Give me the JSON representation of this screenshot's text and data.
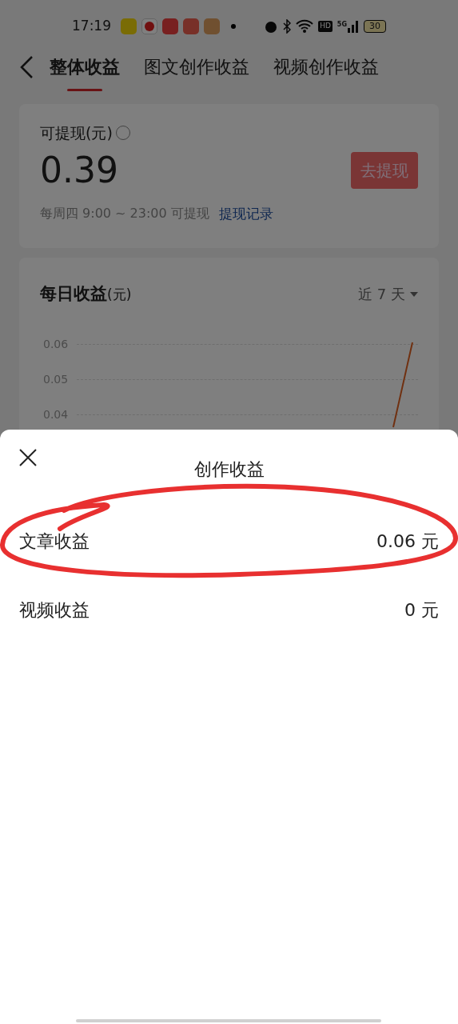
{
  "status_bar": {
    "time": "17:19",
    "battery": "30",
    "network": "5G",
    "hd": "HD"
  },
  "tabs": [
    {
      "label": "整体收益",
      "selected": true
    },
    {
      "label": "图文创作收益",
      "selected": false
    },
    {
      "label": "视频创作收益",
      "selected": false
    }
  ],
  "balance_card": {
    "label": "可提现(元)",
    "amount": "0.39",
    "button": "去提现",
    "note": "每周四 9:00 ~ 23:00 可提现",
    "link": "提现记录"
  },
  "daily_card": {
    "title": "每日收益",
    "unit": "(元)",
    "range": "近 7 天",
    "y_ticks": [
      "0.06",
      "0.05",
      "0.04"
    ]
  },
  "sheet": {
    "title": "创作收益",
    "rows": [
      {
        "label": "文章收益",
        "value": "0.06 元",
        "circled": true
      },
      {
        "label": "视频收益",
        "value": "0 元",
        "circled": false
      }
    ]
  }
}
